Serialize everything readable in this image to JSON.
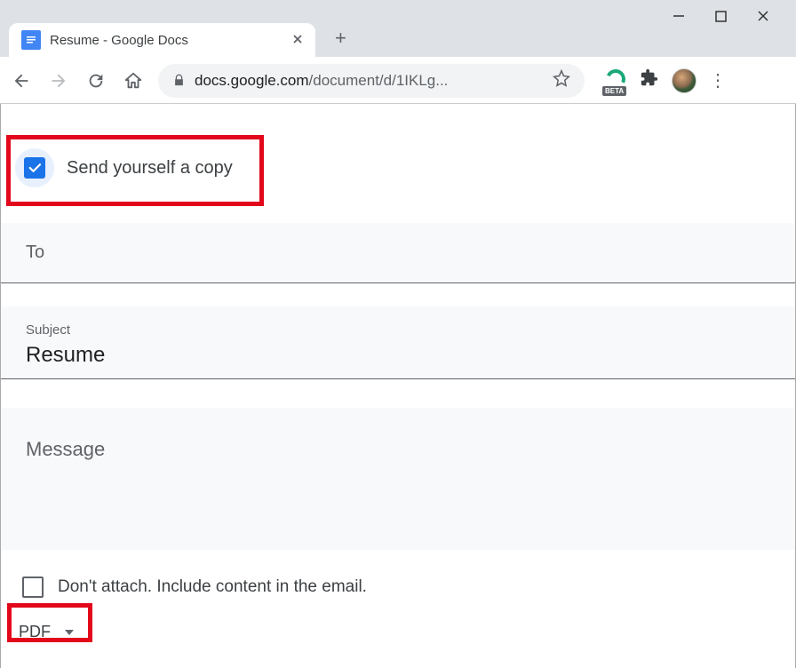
{
  "browser": {
    "tab_title": "Resume - Google Docs",
    "url_host": "docs.google.com",
    "url_path": "/document/d/1IKLg...",
    "beta_label": "BETA"
  },
  "dialog": {
    "send_copy_label": "Send yourself a copy",
    "to_label": "To",
    "subject_label": "Subject",
    "subject_value": "Resume",
    "message_label": "Message",
    "dont_attach_label": "Don't attach. Include content in the email.",
    "format_label": "PDF"
  }
}
